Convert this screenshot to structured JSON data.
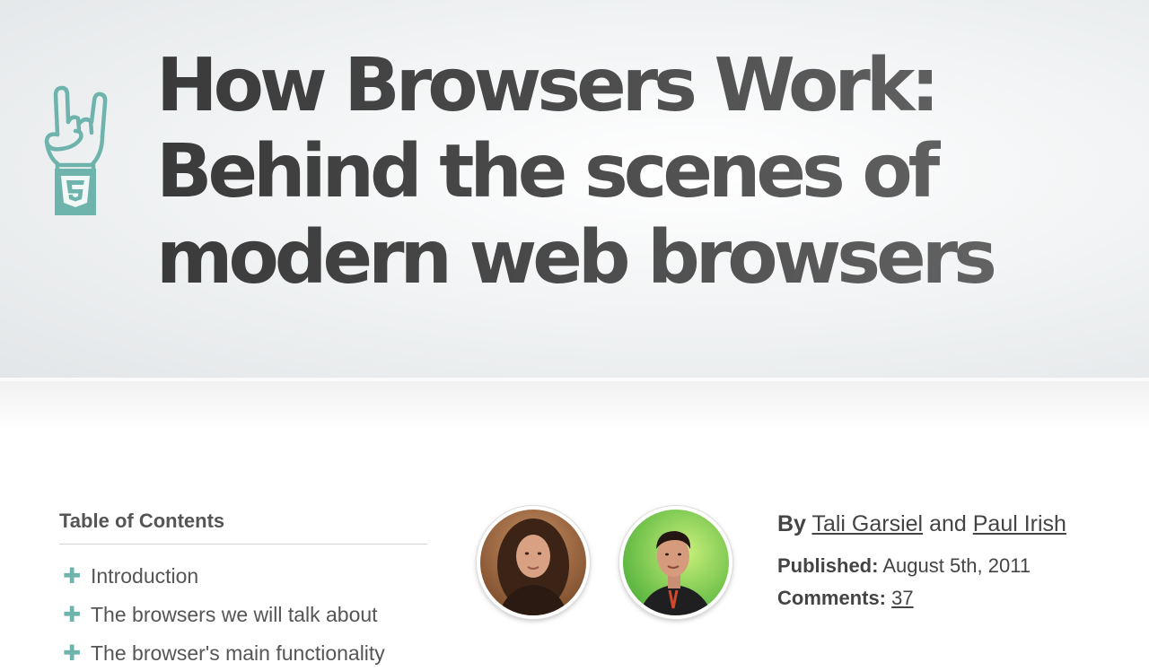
{
  "header": {
    "title": "How Browsers Work: Behind the scenes of modern web browsers",
    "logo_icon": "html5-rock-hand-icon",
    "logo_color": "#6fb3ad"
  },
  "toc": {
    "heading": "Table of Contents",
    "items": [
      {
        "label": "Introduction"
      },
      {
        "label": "The browsers we will talk about"
      },
      {
        "label": "The browser's main functionality"
      }
    ]
  },
  "authors": {
    "by_label": "By",
    "and_label": "and",
    "author_1": "Tali Garsiel",
    "author_2": "Paul Irish",
    "published_label": "Published:",
    "published_date": "August 5th, 2011",
    "comments_label": "Comments:",
    "comments_count": "37"
  }
}
